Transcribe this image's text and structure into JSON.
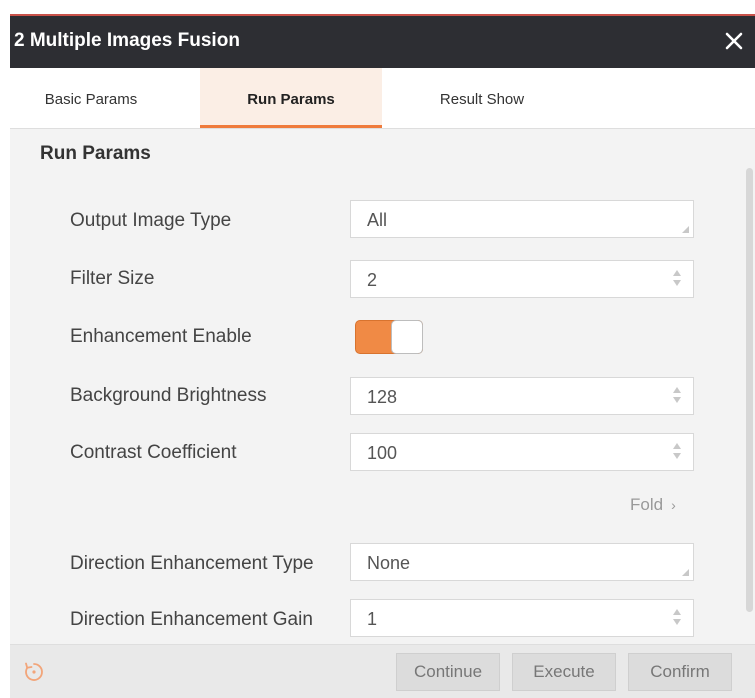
{
  "window": {
    "title": "2 Multiple Images Fusion",
    "close_icon": "close-icon",
    "accent_color": "#ef7b3c"
  },
  "tabs": [
    {
      "label": "Basic Params",
      "active": false
    },
    {
      "label": "Run Params",
      "active": true
    },
    {
      "label": "Result Show",
      "active": false
    }
  ],
  "section": {
    "title": "Run Params"
  },
  "params": {
    "output_image_type": {
      "label": "Output Image Type",
      "value": "All"
    },
    "filter_size": {
      "label": "Filter Size",
      "value": "2"
    },
    "enhancement_enable": {
      "label": "Enhancement Enable",
      "on": true
    },
    "background_brightness": {
      "label": "Background Brightness",
      "value": "128"
    },
    "contrast_coefficient": {
      "label": "Contrast Coefficient",
      "value": "100"
    },
    "direction_enhancement_type": {
      "label": "Direction Enhancement Type",
      "value": "None"
    },
    "direction_enhancement_gain": {
      "label": "Direction Enhancement Gain",
      "value": "1"
    }
  },
  "fold": {
    "label": "Fold",
    "chevron": "›"
  },
  "footer": {
    "reset_icon": "reset-icon",
    "continue_label": "Continue",
    "execute_label": "Execute",
    "confirm_label": "Confirm"
  }
}
